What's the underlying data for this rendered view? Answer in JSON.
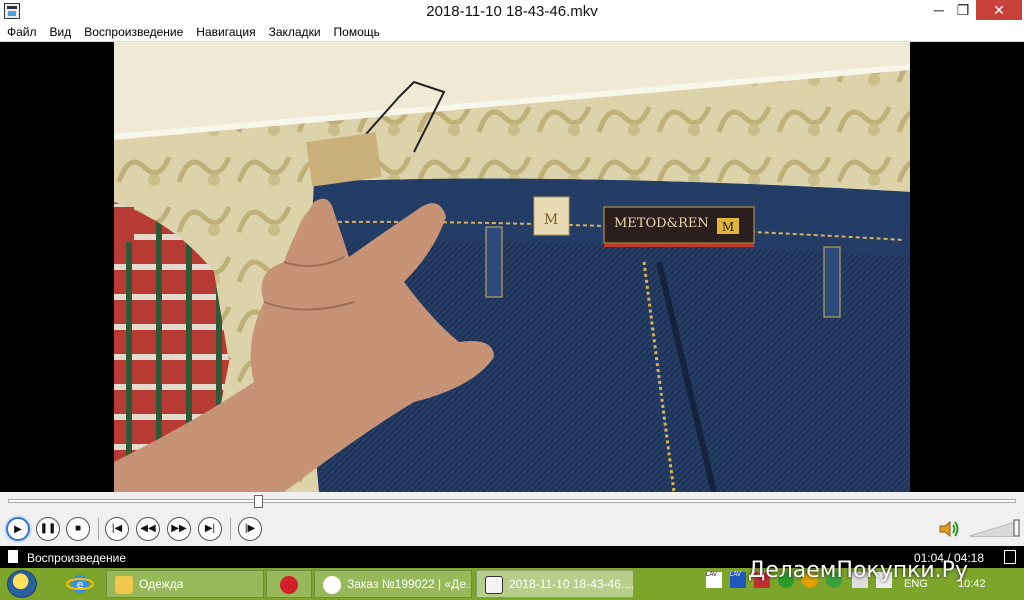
{
  "window": {
    "title": "2018-11-10 18-43-46.mkv",
    "minimize_glyph": "─",
    "restore_glyph": "❐",
    "close_glyph": "✕"
  },
  "menu": [
    "Файл",
    "Вид",
    "Воспроизведение",
    "Навигация",
    "Закладки",
    "Помощь"
  ],
  "video": {
    "label_text": "METOD&REN",
    "label_letter": "M",
    "patch_letter": "M"
  },
  "playback": {
    "progress_fraction": 0.248
  },
  "controls": {
    "icons": [
      "play-icon",
      "pause-icon",
      "stop-icon",
      "prev-icon",
      "rewind-icon",
      "forward-icon",
      "next-icon",
      "frame-step-icon"
    ],
    "volume_fraction": 1.0
  },
  "status": {
    "text": "Воспроизведение",
    "time": "01:04 / 04:18"
  },
  "taskbar": {
    "tasks": [
      {
        "label": "Одежда"
      },
      {
        "label": "Заказ №199022 | «Де..."
      },
      {
        "label": "2018-11-10 18-43-46...."
      }
    ],
    "lang": "ENG",
    "clock": "10:42",
    "tray_labels": [
      "LAV",
      "LAV",
      "LAV"
    ]
  },
  "watermark": "ДелаемПокупки.Ру",
  "colors": {
    "close_button": "#c8413a",
    "taskbar": "#7da52b",
    "accent": "#3a74c8"
  }
}
